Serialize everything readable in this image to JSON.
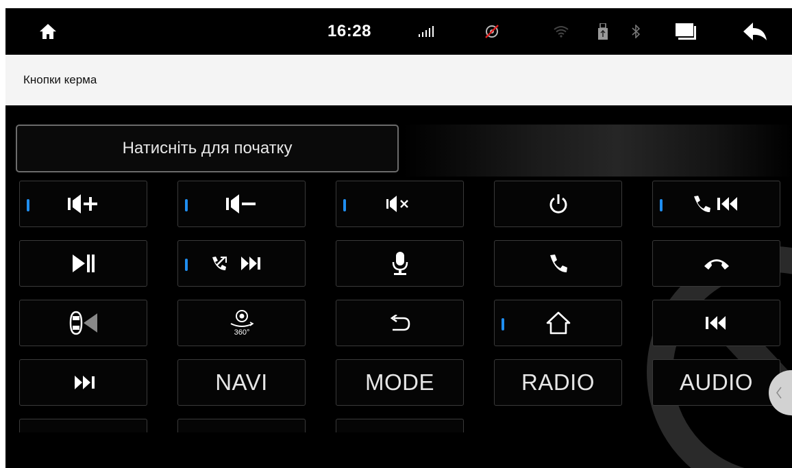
{
  "status_bar": {
    "time": "16:28",
    "icons": [
      "home-icon",
      "signal-bars-icon",
      "gps-off-icon",
      "wifi-icon",
      "usb-icon",
      "bluetooth-icon",
      "recent-apps-icon",
      "back-arrow-icon"
    ]
  },
  "page": {
    "title": "Кнопки керма"
  },
  "start_button": {
    "label": "Натисніть для початку"
  },
  "buttons": {
    "row1": [
      "volume-up-icon",
      "volume-down-icon",
      "mute-icon",
      "power-icon",
      "call-previous-icon"
    ],
    "row2": [
      "play-pause-icon",
      "hangup-next-icon",
      "microphone-icon",
      "phone-answer-icon",
      "phone-hangup-icon"
    ],
    "row3": [
      "car-radar-icon",
      "camera-360-icon",
      "return-icon",
      "home-outline-icon",
      "previous-track-icon"
    ],
    "row4": [
      "next-track-icon",
      "NAVI",
      "MODE",
      "RADIO",
      "AUDIO"
    ]
  },
  "colors": {
    "background": "#000000",
    "indicator": "#1f8ef0",
    "title_bar": "#f4f4f4"
  }
}
